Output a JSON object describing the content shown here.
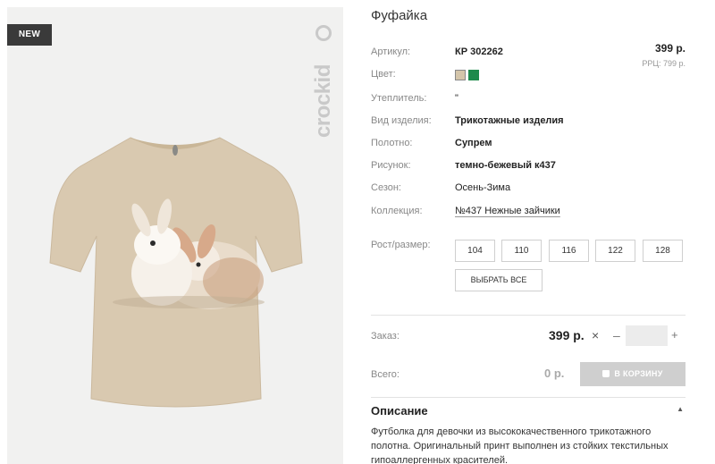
{
  "photo": {
    "badge": "NEW",
    "brand": "crockid"
  },
  "product": {
    "title": "Фуфайка",
    "price": "399 р.",
    "rrp": "РРЦ: 799 р."
  },
  "details": [
    {
      "label": "Артикул:",
      "value": "КР 302262"
    },
    {
      "label": "Цвет:",
      "value": ""
    },
    {
      "label": "Утеплитель:",
      "value": "\""
    },
    {
      "label": "Вид изделия:",
      "value": "Трикотажные изделия"
    },
    {
      "label": "Полотно:",
      "value": "Супрем"
    },
    {
      "label": "Рисунок:",
      "value": "темно-бежевый к437"
    },
    {
      "label": "Сезон:",
      "value": "Осень-Зима"
    },
    {
      "label": "Коллекция:",
      "value": "№437 Нежные зайчики"
    }
  ],
  "colors": [
    "#d4c5aa",
    "#1e8a4c"
  ],
  "sizes": {
    "label": "Рост/размер:",
    "options": [
      "104",
      "110",
      "116",
      "122",
      "128"
    ],
    "select_all": "ВЫБРАТЬ ВСЕ"
  },
  "order": {
    "label": "Заказ:",
    "price": "399 р.",
    "times": "×",
    "minus": "–",
    "plus": "+",
    "quantity": ""
  },
  "total": {
    "label": "Всего:",
    "value": "0 р.",
    "cart_button": "В КОРЗИНУ"
  },
  "description": {
    "title": "Описание",
    "caret": "▲",
    "text": "Футболка для девочки из высококачественного трикотажного полотна. Оригинальный принт выполнен из стойких текстильных гипоаллергенных красителей."
  }
}
